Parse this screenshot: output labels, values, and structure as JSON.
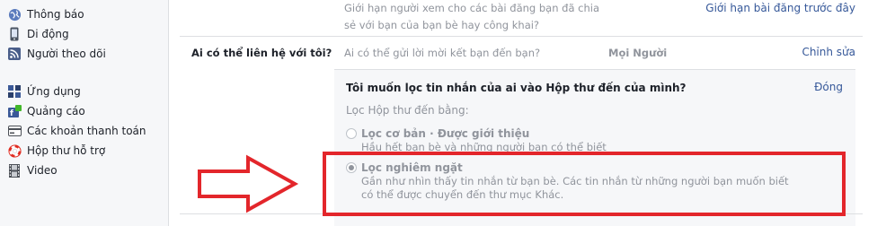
{
  "sidebar": {
    "items": [
      {
        "label": "Thông báo",
        "icon": "globe-icon"
      },
      {
        "label": "Di động",
        "icon": "mobile-icon"
      },
      {
        "label": "Người theo dõi",
        "icon": "rss-icon"
      },
      {
        "label": "Ứng dụng",
        "icon": "apps-icon"
      },
      {
        "label": "Quảng cáo",
        "icon": "ads-icon"
      },
      {
        "label": "Các khoản thanh toán",
        "icon": "payment-card-icon"
      },
      {
        "label": "Hộp thư hỗ trợ",
        "icon": "lifebuoy-icon"
      },
      {
        "label": "Video",
        "icon": "film-icon"
      }
    ]
  },
  "top_row": {
    "description": "Giới hạn người xem cho các bài đăng bạn đã chia sẻ với bạn của bạn bè hay công khai?",
    "link": "Giới hạn bài đăng trước đây"
  },
  "contact_section": {
    "label": "Ai có thể liên hệ với tôi?",
    "question": "Ai có thể gửi lời mời kết bạn đến bạn?",
    "value": "Mọi Người",
    "edit_link": "Chỉnh sửa"
  },
  "filter_panel": {
    "question": "Tôi muốn lọc tin nhắn của ai vào Hộp thư đến của mình?",
    "close_link": "Đóng",
    "filter_label": "Lọc Hộp thư đến bằng:",
    "options": [
      {
        "title": "Lọc cơ bản · Được giới thiệu",
        "desc": "Hầu hết bạn bè và những người bạn có thể biết",
        "checked": false
      },
      {
        "title": "Lọc nghiêm ngặt",
        "desc_line1": "Gần như nhìn thấy tin nhắn từ bạn bè. Các tin nhắn từ những người bạn muốn biết",
        "desc_line2": "có thể được chuyển đến thư mục Khác.",
        "checked": true
      }
    ]
  },
  "colors": {
    "annotation": "#e3262b",
    "link": "#365899",
    "muted": "#90949c"
  }
}
